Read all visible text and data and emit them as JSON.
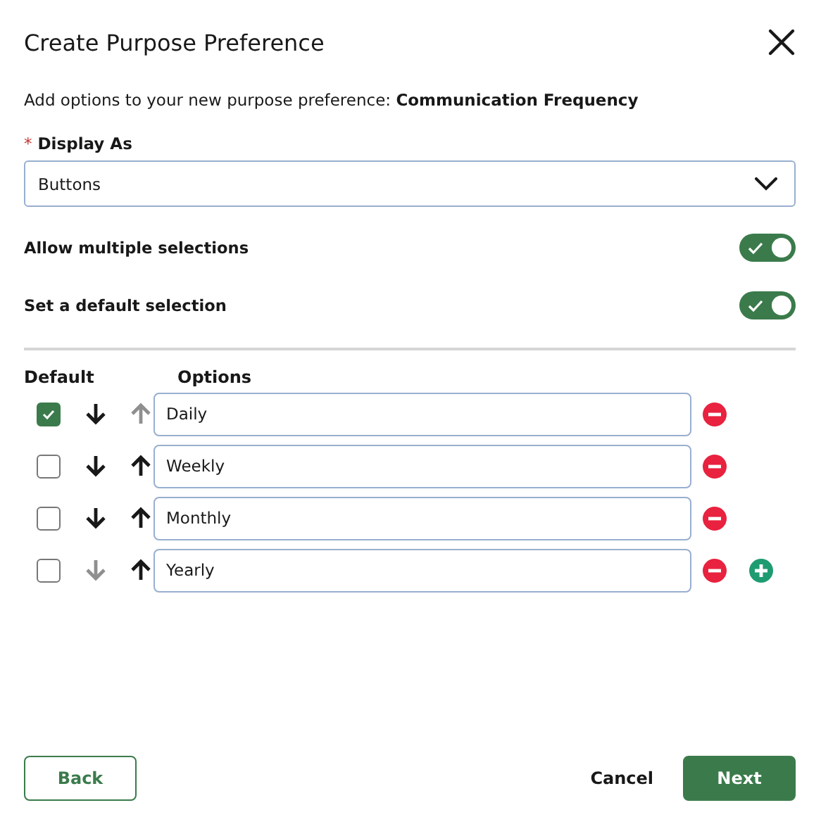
{
  "dialog": {
    "title": "Create Purpose Preference",
    "intro": "Add options to your new purpose preference: **Communication Frequency**"
  },
  "display_as": {
    "required_mark": "*",
    "label": "Display As",
    "value": "Buttons"
  },
  "toggles": [
    {
      "label": "Allow multiple selections",
      "on": true
    },
    {
      "label": "Set a default selection",
      "on": true
    }
  ],
  "options_table": {
    "columns": [
      "Default",
      "Options"
    ],
    "rows": [
      {
        "checked": true,
        "down_disabled": false,
        "up_disabled": true,
        "value": "Daily",
        "can_add": false
      },
      {
        "checked": false,
        "down_disabled": false,
        "up_disabled": false,
        "value": "Weekly",
        "can_add": false
      },
      {
        "checked": false,
        "down_disabled": false,
        "up_disabled": false,
        "value": "Monthly",
        "can_add": false
      },
      {
        "checked": false,
        "down_disabled": true,
        "up_disabled": false,
        "value": "Yearly",
        "can_add": true
      }
    ]
  },
  "footer": {
    "back": "Back",
    "cancel": "Cancel",
    "next": "Next"
  }
}
